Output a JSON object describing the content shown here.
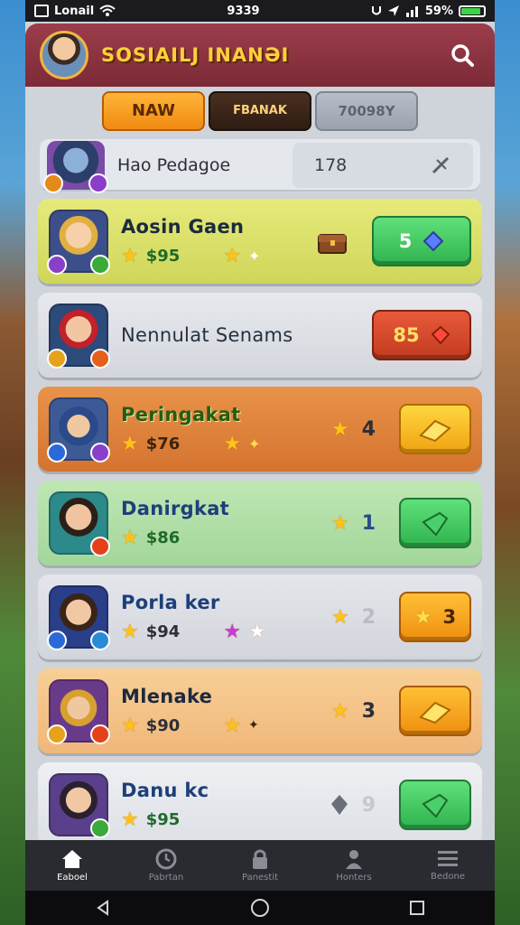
{
  "status_bar": {
    "carrier": "Lonail",
    "time": "9339",
    "battery": "59%"
  },
  "header": {
    "title": "SOSIAILJ INANƏI"
  },
  "tabs": [
    {
      "label": "NAW",
      "active": true
    },
    {
      "label": "FBANAK",
      "active": false
    },
    {
      "label": "70098Y",
      "active": false
    }
  ],
  "search_row": {
    "name": "Hao Pedagoe",
    "count": "178"
  },
  "cards": [
    {
      "name": "Aosin Gaen",
      "stat": "$95",
      "button": "5",
      "button_icon": "gem-icon"
    },
    {
      "name": "Nennulat Senams",
      "button": "85"
    },
    {
      "name": "Peringakat",
      "stat": "$76",
      "mid": "4"
    },
    {
      "name": "Danirgkat",
      "stat": "$86",
      "mid": "1"
    },
    {
      "name": "Porla ker",
      "stat": "$94",
      "mid": "2",
      "button": "3"
    },
    {
      "name": "Mlenake",
      "stat": "$90",
      "mid": "3"
    },
    {
      "name": "Danu kc",
      "stat": "$95",
      "mid": "9"
    }
  ],
  "bottom_nav": [
    {
      "label": "Eaboel",
      "icon": "home-icon",
      "active": true
    },
    {
      "label": "Pabrtan",
      "icon": "clock-icon",
      "active": false
    },
    {
      "label": "Panestit",
      "icon": "lock-icon",
      "active": false
    },
    {
      "label": "Honters",
      "icon": "user-icon",
      "active": false
    },
    {
      "label": "Bedone",
      "icon": "menu-icon",
      "active": false
    }
  ],
  "colors": {
    "header": "#8a3341",
    "title": "#ffcf3f",
    "green_button": "#2fb34e",
    "gold_button": "#f0a312"
  }
}
